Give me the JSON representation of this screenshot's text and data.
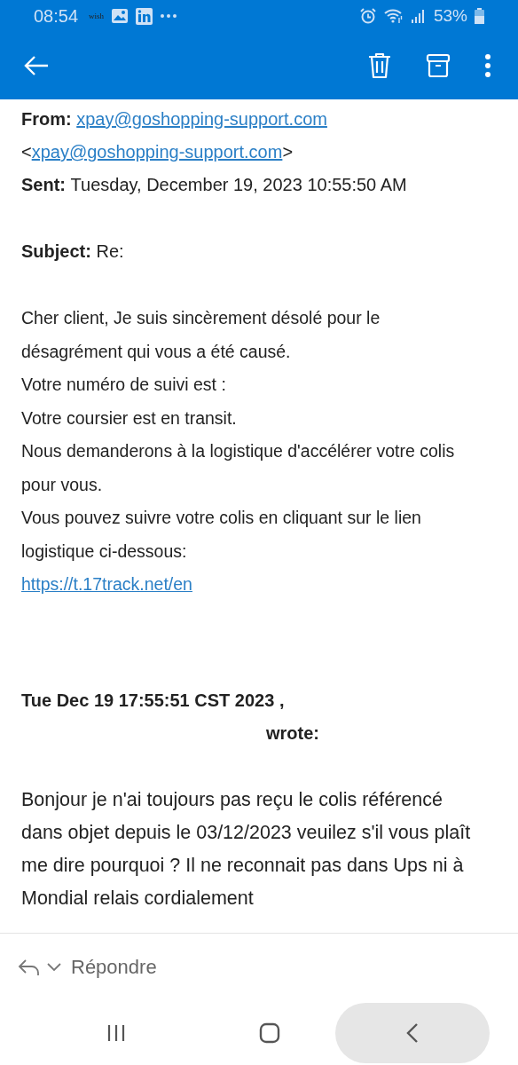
{
  "status_bar": {
    "time": "08:54",
    "notification_label": "wish",
    "battery": "53%"
  },
  "header": {
    "from_label": "From:",
    "from_link": "xpay@goshopping-support.com",
    "from_link_bracketed": "xpay@goshopping-support.com",
    "open_bracket": "<",
    "close_bracket": ">",
    "sent_label": "Sent:",
    "sent_value": "Tuesday, December 19, 2023 10:55:50 AM",
    "subject_label": "Subject:",
    "subject_value": "Re:"
  },
  "body": [
    {
      "kind": "text",
      "text": "Cher client,  Je suis sincèrement désolé pour le désagrément qui vous a été causé."
    },
    {
      "kind": "text",
      "text": "Votre numéro de suivi est :"
    },
    {
      "kind": "text",
      "text": "Votre coursier est en transit."
    },
    {
      "kind": "text",
      "text": "Nous demanderons à la logistique d'accélérer votre colis pour vous."
    },
    {
      "kind": "text",
      "text": "Vous pouvez suivre votre colis en cliquant sur le lien logistique ci-dessous:"
    },
    {
      "kind": "link",
      "text": "https://t.17track.net/en"
    }
  ],
  "quote": {
    "date_line": "Tue Dec 19 17:55:51 CST 2023 ,",
    "wrote": "wrote:",
    "text": "Bonjour je n'ai toujours pas reçu le colis référencé dans objet depuis le 03/12/2023 veuilez s'il vous plaît me dire pourquoi ? Il ne reconnait pas dans Ups ni à Mondial relais cordialement"
  },
  "reply_bar": {
    "label": "Répondre"
  }
}
